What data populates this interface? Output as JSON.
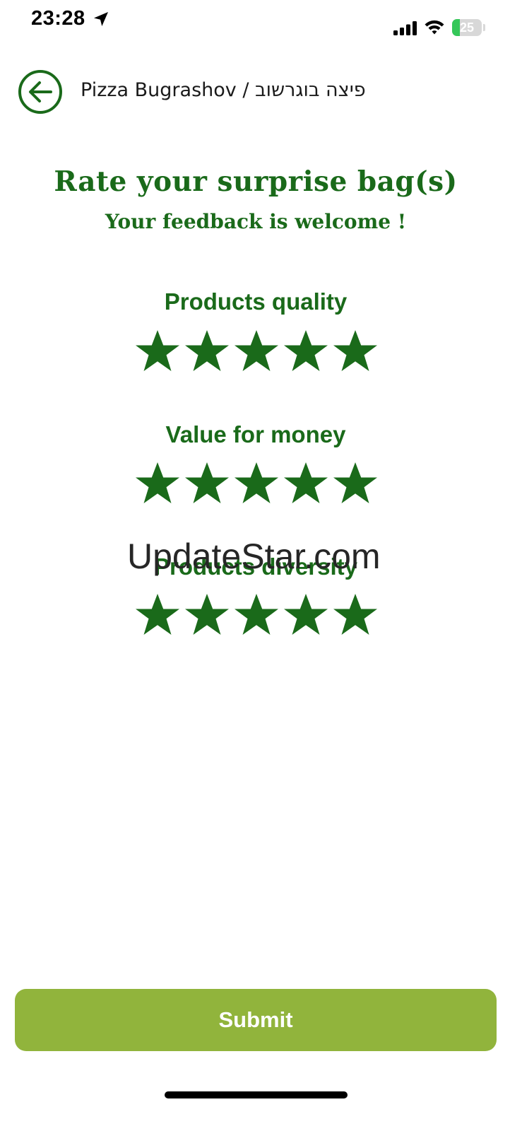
{
  "status_bar": {
    "time": "23:28",
    "battery_percent": 25,
    "battery_label": "25",
    "location_icon": "location-arrow-icon",
    "signal_icon": "cellular-signal-icon",
    "wifi_icon": "wifi-icon",
    "battery_icon": "battery-charging-icon"
  },
  "header": {
    "back_icon": "arrow-left-icon",
    "title": "Pizza Bugrashov / פיצה בוגרשוב"
  },
  "heading": {
    "title": "Rate your surprise bag(s)",
    "subtitle": "Your feedback is welcome !"
  },
  "ratings": [
    {
      "label": "Products quality",
      "max_stars": 5,
      "filled_stars": 5
    },
    {
      "label": "Value for money",
      "max_stars": 5,
      "filled_stars": 5
    },
    {
      "label": "Products diversity",
      "max_stars": 5,
      "filled_stars": 5
    }
  ],
  "watermark": "UpdateStar.com",
  "submit_label": "Submit",
  "colors": {
    "primary_green": "#1a6a1a",
    "submit_background": "#91b43c",
    "battery_green": "#35c759"
  }
}
